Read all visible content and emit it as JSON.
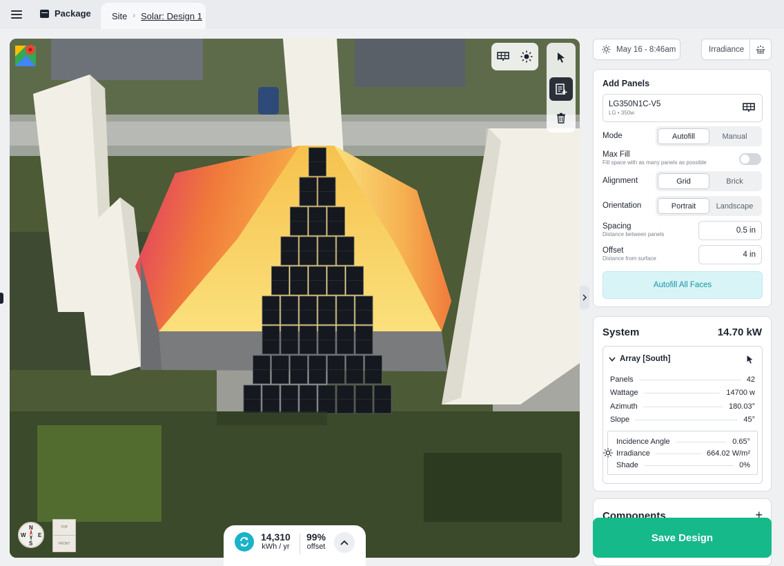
{
  "topbar": {
    "package_label": "Package",
    "breadcrumb": {
      "site": "Site",
      "separator": "›",
      "design": "Solar: Design 1"
    }
  },
  "map": {
    "compass": {
      "n": "N",
      "s": "S",
      "e": "E",
      "w": "W"
    },
    "view_cube": {
      "top": "TOP",
      "front": "FRONT"
    },
    "icons": [
      "google-maps-logo",
      "solar-panel-icon",
      "sun-icon",
      "cursor-icon",
      "add-panel-icon",
      "trash-icon"
    ]
  },
  "stats": {
    "energy_value": "14,310",
    "energy_unit": "kWh / yr",
    "offset_value": "99%",
    "offset_unit": "offset"
  },
  "header_controls": {
    "date_label": "May 16 - 8:46am",
    "irradiance_label": "Irradiance"
  },
  "add_panels": {
    "title": "Add Panels",
    "panel_name": "LG350N1C-V5",
    "panel_sub": "LG • 350w",
    "mode": {
      "label": "Mode",
      "options": [
        "Autofill",
        "Manual"
      ],
      "selected": "Autofill"
    },
    "max_fill": {
      "label": "Max Fill",
      "sub": "Fill space with as many panels as possible",
      "enabled": false
    },
    "alignment": {
      "label": "Alignment",
      "options": [
        "Grid",
        "Brick"
      ],
      "selected": "Grid"
    },
    "orientation": {
      "label": "Orientation",
      "options": [
        "Portrait",
        "Landscape"
      ],
      "selected": "Portrait"
    },
    "spacing": {
      "label": "Spacing",
      "sub": "Distance between panels",
      "value": "0.5 in"
    },
    "offset": {
      "label": "Offset",
      "sub": "Distance from surface",
      "value": "4 in"
    },
    "autofill_button": "Autofill All Faces"
  },
  "system": {
    "title": "System",
    "total": "14.70 kW",
    "array": {
      "name": "Array [South]",
      "rows": [
        {
          "label": "Panels",
          "value": "42"
        },
        {
          "label": "Wattage",
          "value": "14700 w"
        },
        {
          "label": "Azimuth",
          "value": "180.03°"
        },
        {
          "label": "Slope",
          "value": "45°"
        }
      ],
      "sun_rows": [
        {
          "label": "Incidence Angle",
          "value": "0.65°"
        },
        {
          "label": "Irradiance",
          "value": "664.02 W/m²"
        },
        {
          "label": "Shade",
          "value": "0%"
        }
      ]
    }
  },
  "components": {
    "title": "Components",
    "add": "+"
  },
  "save_button": "Save Design",
  "colors": {
    "accent_green": "#16b98a",
    "accent_teal": "#19b3c8",
    "autofill_bg": "#d9f4f7"
  }
}
